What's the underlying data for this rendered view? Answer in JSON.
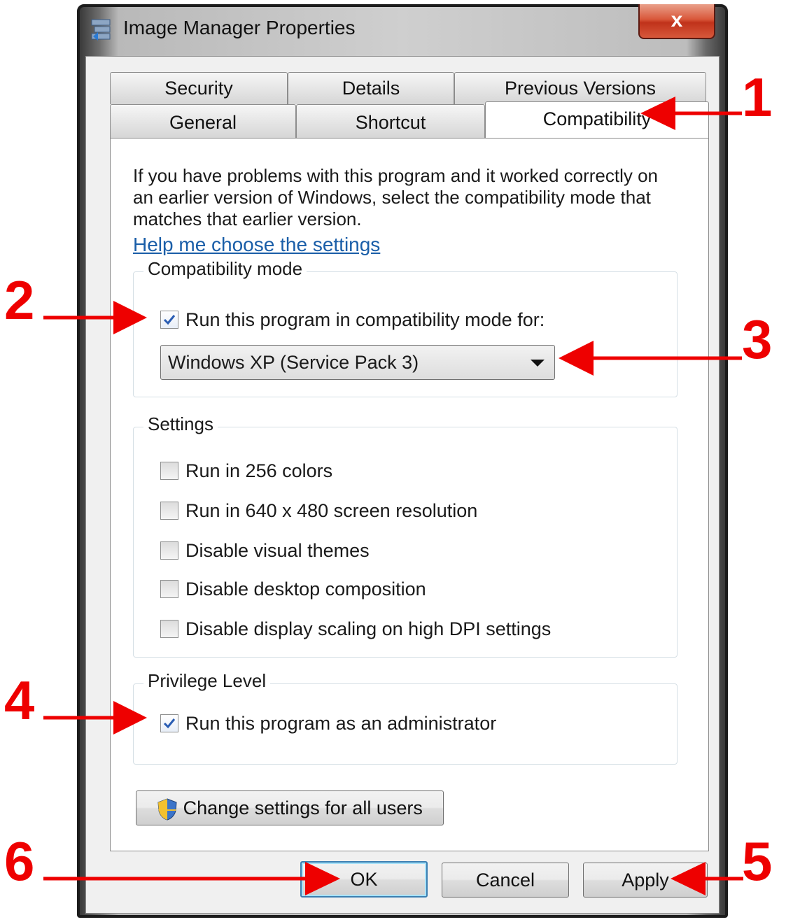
{
  "window": {
    "title": "Image Manager Properties",
    "close_label": "x"
  },
  "tabs": {
    "row1": [
      "Security",
      "Details",
      "Previous Versions"
    ],
    "row2": [
      "General",
      "Shortcut",
      "Compatibility"
    ],
    "active": "Compatibility"
  },
  "compat": {
    "description": "If you have problems with this program and it worked correctly on an earlier version of Windows, select the compatibility mode that matches that earlier version.",
    "help_link": "Help me choose the settings",
    "mode_group_label": "Compatibility mode",
    "mode_checkbox_label": "Run this program in compatibility mode for:",
    "mode_checked": true,
    "mode_selected": "Windows XP (Service Pack 3)",
    "settings_group_label": "Settings",
    "settings": [
      {
        "label": "Run in 256 colors",
        "checked": false
      },
      {
        "label": "Run in 640 x 480 screen resolution",
        "checked": false
      },
      {
        "label": "Disable visual themes",
        "checked": false
      },
      {
        "label": "Disable desktop composition",
        "checked": false
      },
      {
        "label": "Disable display scaling on high DPI settings",
        "checked": false
      }
    ],
    "privilege_group_label": "Privilege Level",
    "privilege_checkbox_label": "Run this program as an administrator",
    "privilege_checked": true,
    "all_users_button": "Change settings for all users"
  },
  "footer": {
    "ok": "OK",
    "cancel": "Cancel",
    "apply": "Apply"
  },
  "annotations": {
    "numbers": [
      "1",
      "2",
      "3",
      "4",
      "5",
      "6"
    ],
    "color": "#ee0000"
  },
  "colors": {
    "link": "#1a5ea8",
    "close_button": "#c0321a",
    "default_button_border": "#3c7fb1"
  }
}
